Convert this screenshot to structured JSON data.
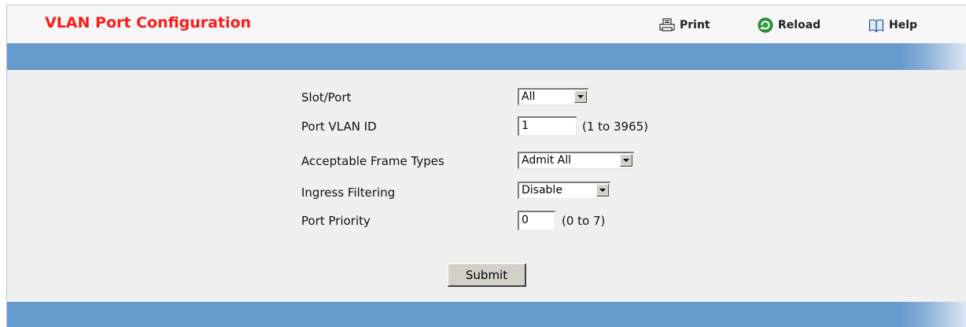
{
  "header": {
    "title": "VLAN Port Configuration",
    "actions": [
      {
        "label": "Print",
        "icon": "printer-icon"
      },
      {
        "label": "Reload",
        "icon": "reload-icon"
      },
      {
        "label": "Help",
        "icon": "book-icon"
      }
    ]
  },
  "colors": {
    "title": "#ff1a1a",
    "band": "#6699cc",
    "content_bg": "#f0f0f0"
  },
  "form": {
    "slot_port": {
      "label": "Slot/Port",
      "value": "All"
    },
    "port_vlan_id": {
      "label": "Port VLAN ID",
      "value": "1",
      "range": "(1 to 3965)"
    },
    "acceptable_frame_types": {
      "label": "Acceptable Frame Types",
      "value": "Admit All"
    },
    "ingress_filtering": {
      "label": "Ingress Filtering",
      "value": "Disable"
    },
    "port_priority": {
      "label": "Port Priority",
      "value": "0",
      "range": "(0 to 7)"
    },
    "submit_label": "Submit"
  }
}
